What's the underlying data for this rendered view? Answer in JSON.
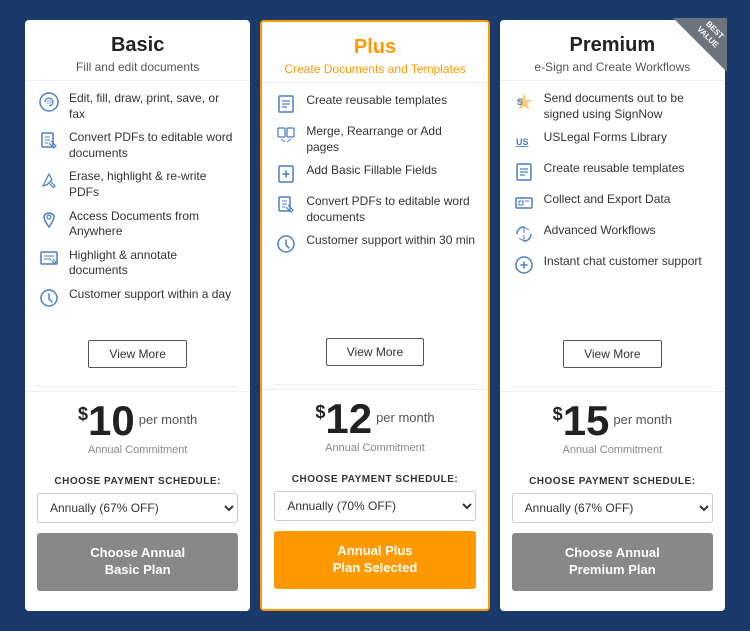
{
  "plans": [
    {
      "id": "basic",
      "name": "Basic",
      "name_color": "normal",
      "subtitle": "Fill and edit documents",
      "subtitle_color": "normal",
      "best_value": false,
      "features": [
        "Edit, fill, draw, print, save, or fax",
        "Convert PDFs to editable word documents",
        "Erase, highlight & re-write PDFs",
        "Access Documents from Anywhere",
        "Highlight & annotate documents",
        "Customer support within a day"
      ],
      "view_more_label": "View More",
      "price_dollar": "$",
      "price": "10",
      "price_per": "per month",
      "annual_commitment": "Annual Commitment",
      "payment_label": "CHOOSE PAYMENT SCHEDULE:",
      "payment_option": "Annually (67% OFF)",
      "button_label": "Choose Annual\nBasic Plan",
      "button_type": "basic"
    },
    {
      "id": "plus",
      "name": "Plus",
      "name_color": "orange",
      "subtitle": "Create Documents and Templates",
      "subtitle_color": "orange",
      "best_value": false,
      "features": [
        "Create reusable templates",
        "Merge, Rearrange or Add pages",
        "Add Basic Fillable Fields",
        "Convert PDFs to editable word documents",
        "Customer support within 30 min"
      ],
      "view_more_label": "View More",
      "price_dollar": "$",
      "price": "12",
      "price_per": "per month",
      "annual_commitment": "Annual Commitment",
      "payment_label": "CHOOSE PAYMENT SCHEDULE:",
      "payment_option": "Annually (70% OFF)",
      "button_label": "Annual Plus\nPlan Selected",
      "button_type": "plus-selected"
    },
    {
      "id": "premium",
      "name": "Premium",
      "name_color": "normal",
      "subtitle": "e-Sign and Create Workflows",
      "subtitle_color": "normal",
      "best_value": true,
      "best_value_text": "BEST\nVALUE",
      "features": [
        "Send documents out to be signed using SignNow",
        "USLegal Forms Library",
        "Create reusable templates",
        "Collect and Export Data",
        "Advanced Workflows",
        "Instant chat customer support"
      ],
      "view_more_label": "View More",
      "price_dollar": "$",
      "price": "15",
      "price_per": "per month",
      "annual_commitment": "Annual Commitment",
      "payment_label": "CHOOSE PAYMENT SCHEDULE:",
      "payment_option": "Annually (67% OFF)",
      "button_label": "Choose Annual\nPremium Plan",
      "button_type": "premium"
    }
  ]
}
